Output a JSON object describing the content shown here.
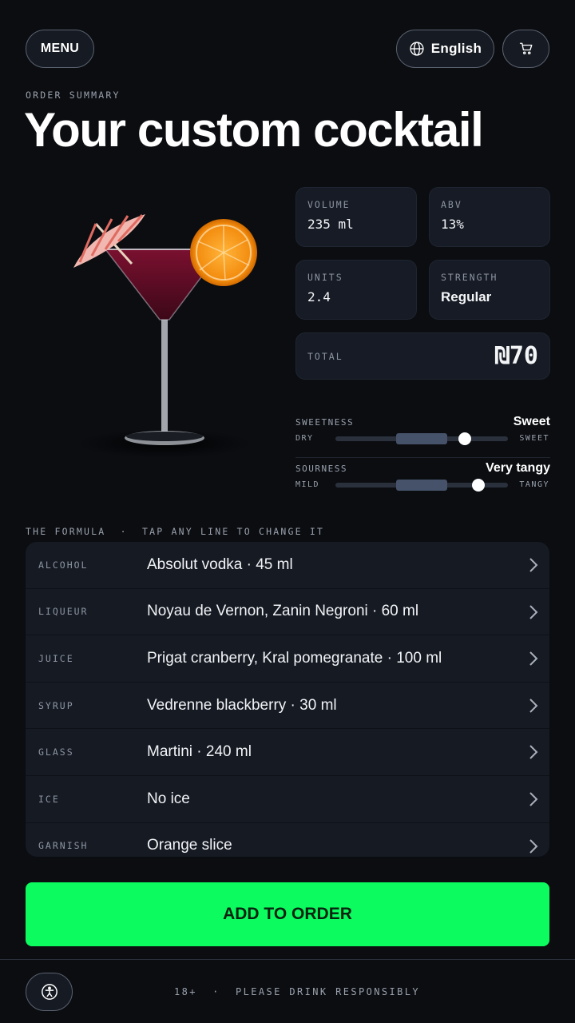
{
  "header": {
    "menu_label": "MENU",
    "language_label": "English",
    "icons": {
      "language": "globe-icon",
      "cart": "cart-icon"
    }
  },
  "page": {
    "eyebrow": "ORDER SUMMARY",
    "title": "Your custom cocktail"
  },
  "stats": {
    "volume": {
      "label": "VOLUME",
      "value": "235 ml"
    },
    "abv": {
      "label": "ABV",
      "value": "13%"
    },
    "units": {
      "label": "UNITS",
      "value": "2.4"
    },
    "strength": {
      "label": "STRENGTH",
      "value": "Regular"
    },
    "total": {
      "label": "TOTAL",
      "value": "₪70"
    }
  },
  "sliders": {
    "sweetness": {
      "label": "SWEETNESS",
      "value": "Sweet",
      "min_label": "DRY",
      "max_label": "SWEET",
      "level": 0.75,
      "band": [
        0.35,
        0.65
      ]
    },
    "sourness": {
      "label": "SOURNESS",
      "value": "Very tangy",
      "min_label": "MILD",
      "max_label": "TANGY",
      "level": 0.83,
      "band": [
        0.35,
        0.65
      ]
    }
  },
  "formula": {
    "heading": "THE FORMULA  ·  TAP ANY LINE TO CHANGE IT",
    "rows": [
      {
        "key": "ALCOHOL",
        "value": "Absolut vodka · 45 ml"
      },
      {
        "key": "LIQUEUR",
        "value": "Noyau de Vernon, Zanin Negroni · 60 ml"
      },
      {
        "key": "JUICE",
        "value": "Prigat cranberry, Kral pomegranate · 100 ml"
      },
      {
        "key": "SYRUP",
        "value": "Vedrenne blackberry · 30 ml"
      },
      {
        "key": "GLASS",
        "value": "Martini · 240 ml"
      },
      {
        "key": "ICE",
        "value": "No ice"
      },
      {
        "key": "GARNISH",
        "value": "Orange slice"
      }
    ]
  },
  "cta": {
    "label": "ADD TO ORDER"
  },
  "footer": {
    "note": "18+  ·  PLEASE DRINK RESPONSIBLY",
    "a11y_icon": "accessibility-icon"
  },
  "colors": {
    "background": "#0b0d11",
    "card": "#161b25",
    "accent": "#0cfc5f"
  }
}
